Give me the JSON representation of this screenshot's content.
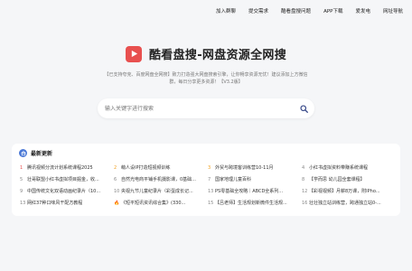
{
  "nav": [
    "加入群聊",
    "提交需求",
    "酷看盘搜问题",
    "APP下载",
    "爱发电",
    "网址导航"
  ],
  "brand": {
    "title": "酷看盘搜-网盘资源全网搜",
    "logo_icon": "play-icon",
    "logo_color": "#e8504f"
  },
  "description": {
    "line1": "【已支持夸克、百度网盘全网搜】致力打造强大网盘搜索引擎，让你畅享资源无忧！建议添加上方微信",
    "line2": "群，每日分享更多资源！【V3.2版】"
  },
  "search": {
    "placeholder": "输入关键字进行搜索",
    "icon": "search-icon"
  },
  "latest": {
    "title": "最新更新",
    "items": [
      {
        "num": "1",
        "text": "腾讯视频分流计划系统课程2025",
        "color": "#e8504f"
      },
      {
        "num": "2",
        "text": "萌人设IP打造短视频训练",
        "color": "#f0a020"
      },
      {
        "num": "3",
        "text": "外贸与跨境客训练营10-11月",
        "color": "#f0a020"
      },
      {
        "num": "4",
        "text": "小红书虚拟资料带赚系统课程",
        "color": "#888888"
      },
      {
        "num": "5",
        "text": "壮哥联盟小红书虚拟项目掘金，收...",
        "color": "#888888"
      },
      {
        "num": "6",
        "text": "自然光电商平铺手机摄影课，0基础...",
        "color": "#888888"
      },
      {
        "num": "7",
        "text": "国家地理儿童百科",
        "color": "#888888"
      },
      {
        "num": "8",
        "text": "【学而思 幼儿园全套课程】",
        "color": "#888888"
      },
      {
        "num": "9",
        "text": "中国传统文化双语动画纪录片（10...",
        "color": "#888888"
      },
      {
        "num": "10",
        "text": "央视九节儿童纪录片（彩蛋成长记...",
        "color": "#888888"
      },
      {
        "num": "13",
        "text": "PS零基础全攻略｜ABCD全系列...",
        "color": "#888888"
      },
      {
        "num": "12",
        "text": "【彩视视频】月薪8万课，附IPho...",
        "color": "#888888"
      },
      {
        "num": "13",
        "text": "网红37种口味风干配方教程",
        "color": "#888888"
      },
      {
        "num": "🔥",
        "text": "《短平短讯资讯综合集》(330...",
        "color": "#888888"
      },
      {
        "num": "15",
        "text": "【吕老师】生活规划新微件生活规...",
        "color": "#888888"
      },
      {
        "num": "16",
        "text": "壮壮独立站训练营，跨通独立站0-...",
        "color": "#888888"
      }
    ]
  }
}
